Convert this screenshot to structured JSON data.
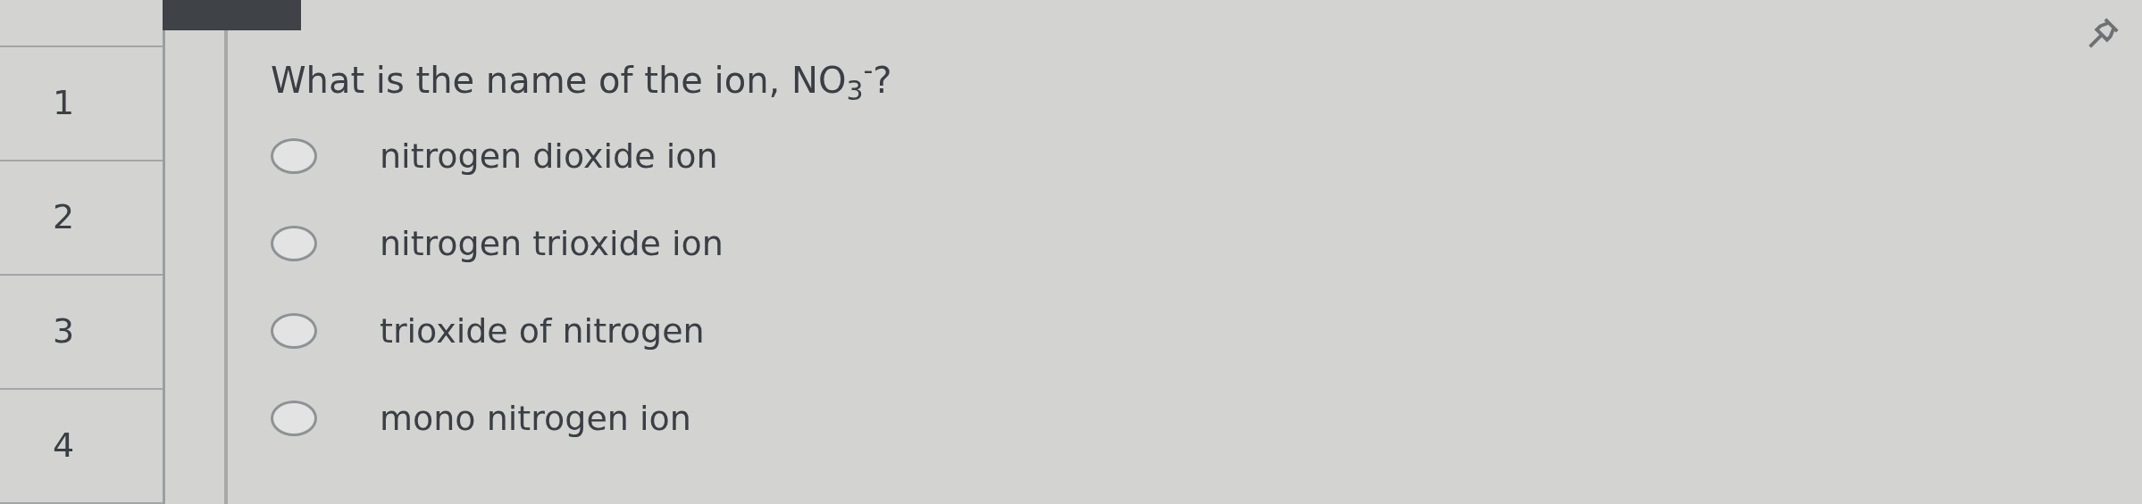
{
  "question_nav": [
    {
      "label": "1",
      "selected": false
    },
    {
      "label": "2",
      "selected": false
    },
    {
      "label": "3",
      "selected": false
    },
    {
      "label": "4",
      "selected": false
    }
  ],
  "question": {
    "text": "What is the name of the ion, NO$_{3}$$^{-}$?",
    "options": [
      {
        "label": "nitrogen dioxide ion",
        "selected": false
      },
      {
        "label": "nitrogen trioxide ion",
        "selected": false
      },
      {
        "label": "trioxide of nitrogen",
        "selected": false
      },
      {
        "label": "mono nitrogen ion",
        "selected": false
      }
    ]
  }
}
